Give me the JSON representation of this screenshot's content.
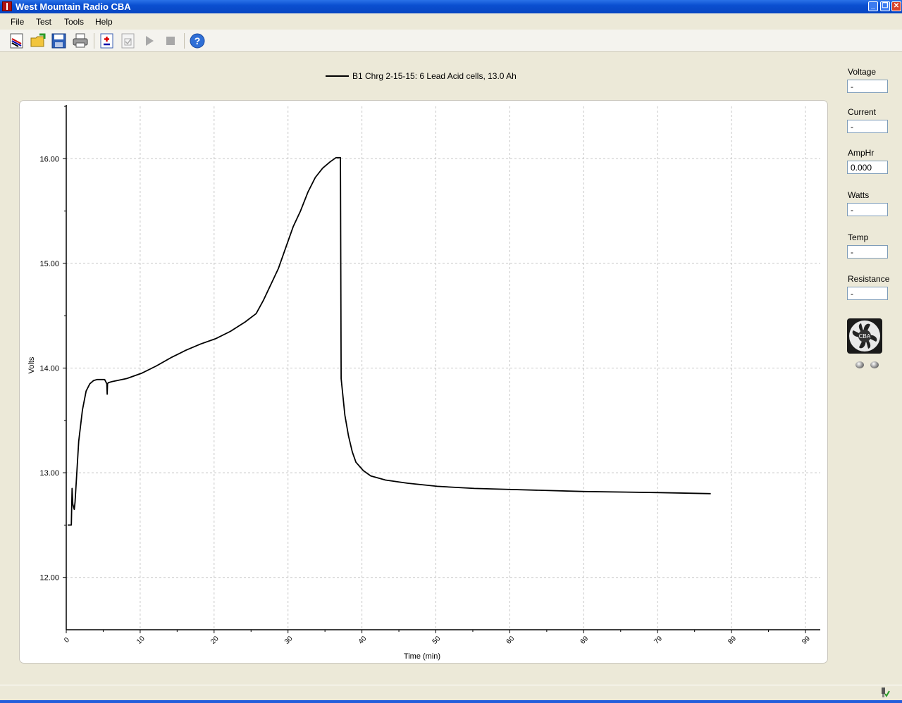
{
  "window": {
    "title": "West Mountain Radio CBA"
  },
  "menu": {
    "items": [
      "File",
      "Test",
      "Tools",
      "Help"
    ]
  },
  "toolbar": {
    "icons": [
      "new-test-icon",
      "open-folder-icon",
      "save-icon",
      "print-icon",
      "add-test-icon",
      "checklist-icon",
      "play-icon",
      "stop-icon",
      "help-icon"
    ]
  },
  "legend": {
    "label": "B1 Chrg 2-15-15: 6 Lead Acid cells, 13.0 Ah"
  },
  "readouts": {
    "voltage": {
      "label": "Voltage",
      "value": "-"
    },
    "current": {
      "label": "Current",
      "value": "-"
    },
    "amphr": {
      "label": "AmpHr",
      "value": "0.000"
    },
    "watts": {
      "label": "Watts",
      "value": "-"
    },
    "temp": {
      "label": "Temp",
      "value": "-"
    },
    "resistance": {
      "label": "Resistance",
      "value": "-"
    }
  },
  "fan_label": "CBA",
  "colors": {
    "titlebar": "#0a4fd0",
    "trace": "#000000",
    "grid": "#c8c8c8",
    "panel": "#ece9d8"
  },
  "chart_data": {
    "type": "line",
    "xlabel": "Time (min)",
    "ylabel": "Volts",
    "xlim": [
      0,
      91
    ],
    "ylim": [
      11.5,
      16.5
    ],
    "xticks": [
      "0",
      "10",
      "20",
      "30",
      "40",
      "50",
      "60",
      "69",
      "79",
      "89",
      "99"
    ],
    "yticks": [
      "12.00",
      "13.00",
      "14.00",
      "15.00",
      "16.00"
    ],
    "grid": true,
    "legend_position": "top-center",
    "series": [
      {
        "name": "B1 Chrg 2-15-15: 6 Lead Acid cells, 13.0 Ah",
        "x": [
          0,
          0.5,
          0.6,
          0.7,
          0.9,
          1.0,
          1.5,
          2.0,
          2.5,
          3.0,
          3.5,
          4.0,
          4.5,
          5.0,
          5.3,
          5.35,
          5.4,
          5.5,
          6,
          8,
          10,
          12,
          14,
          16,
          18,
          20,
          22,
          24,
          25.5,
          26.5,
          27.5,
          28.5,
          29.5,
          30.5,
          31.5,
          32.5,
          33.5,
          34.5,
          35.5,
          36.3,
          36.9,
          37.0,
          37.5,
          38,
          38.5,
          39,
          40,
          41,
          43,
          46,
          50,
          55,
          60,
          70,
          80,
          87
        ],
        "y": [
          12.5,
          12.5,
          12.85,
          12.7,
          12.65,
          12.72,
          13.3,
          13.6,
          13.78,
          13.85,
          13.88,
          13.89,
          13.89,
          13.89,
          13.85,
          13.75,
          13.85,
          13.86,
          13.87,
          13.9,
          13.95,
          14.02,
          14.1,
          14.17,
          14.23,
          14.28,
          14.35,
          14.44,
          14.52,
          14.65,
          14.8,
          14.95,
          15.15,
          15.35,
          15.5,
          15.68,
          15.82,
          15.91,
          15.97,
          16.01,
          16.01,
          13.9,
          13.55,
          13.35,
          13.2,
          13.1,
          13.02,
          12.97,
          12.93,
          12.9,
          12.87,
          12.85,
          12.84,
          12.82,
          12.81,
          12.8
        ]
      }
    ]
  }
}
